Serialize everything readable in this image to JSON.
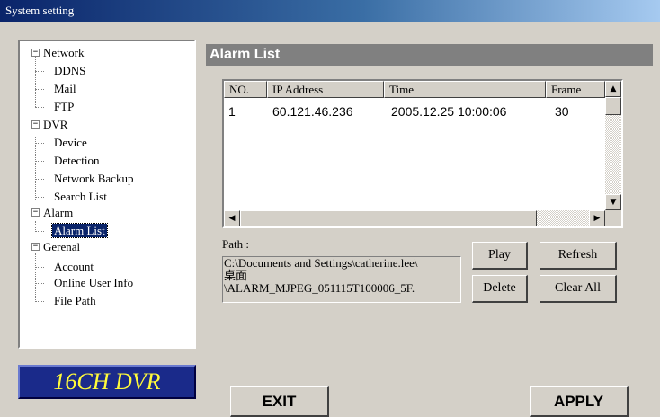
{
  "window": {
    "title": "System setting"
  },
  "tree": {
    "groups": [
      {
        "label": "Network",
        "children": [
          "DDNS",
          "Mail",
          "FTP"
        ]
      },
      {
        "label": "DVR",
        "children": [
          "Device",
          "Detection",
          "Network Backup",
          "Search List"
        ]
      },
      {
        "label": "Alarm",
        "children": [
          "Alarm List"
        ]
      },
      {
        "label": "Gerenal",
        "children": [
          "Account",
          "Online User Info",
          "File Path"
        ]
      }
    ],
    "selected": "Alarm List",
    "expander_symbol": "−"
  },
  "brand": {
    "text": "16CH DVR",
    "color": "#fffb3b",
    "background": "#1a2a8a"
  },
  "panel": {
    "title": "Alarm List"
  },
  "alarm_table": {
    "columns": [
      "NO.",
      "IP Address",
      "Time",
      "Frame"
    ],
    "rows": [
      {
        "no": "1",
        "ip": "60.121.46.236",
        "time": "2005.12.25 10:00:06",
        "frame": "30"
      }
    ]
  },
  "scroll": {
    "up": "▲",
    "down": "▼",
    "left": "◀",
    "right": "▶"
  },
  "path": {
    "label": "Path :",
    "lines": [
      "C:\\Documents and Settings\\catherine.lee\\",
      "桌面",
      "\\ALARM_MJPEG_051115T100006_5F."
    ]
  },
  "buttons": {
    "play": "Play",
    "refresh": "Refresh",
    "delete": "Delete",
    "clear_all": "Clear All",
    "exit": "EXIT",
    "apply": "APPLY"
  }
}
